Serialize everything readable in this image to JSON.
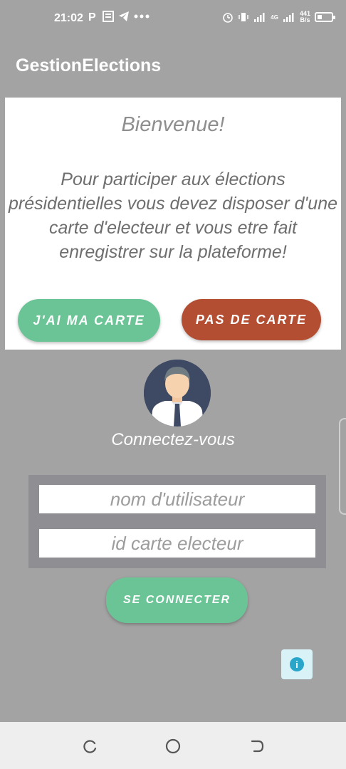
{
  "status_bar": {
    "time": "21:02",
    "left_icons": [
      "p-icon",
      "news-icon",
      "telegram-icon",
      "more-dots-icon"
    ],
    "network_speed_value": "441",
    "network_speed_unit": "B/s",
    "signal_type": "4G"
  },
  "app_bar": {
    "title": "GestionElections"
  },
  "welcome": {
    "title": "Bienvenue!",
    "text": "Pour participer aux élections présidentielles vous devez disposer d'une carte d'electeur et vous etre fait enregistrer sur la plateforme!",
    "have_card_label": "J'AI MA CARTE",
    "no_card_label": "PAS DE CARTE"
  },
  "login": {
    "title": "Connectez-vous",
    "username_placeholder": "nom d'utilisateur",
    "card_id_placeholder": "id carte electeur",
    "submit_label": "SE CONNECTER"
  },
  "colors": {
    "primary_green": "#6bc496",
    "rust": "#b34e33",
    "overlay_gray": "#a3a3a3",
    "info_blue": "#29a6c9"
  }
}
